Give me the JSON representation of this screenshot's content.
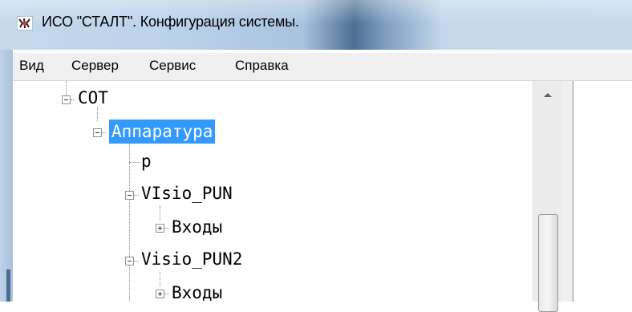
{
  "window": {
    "title": "ИСО \"СТАЛТ\". Конфигурация системы.",
    "icon": "app-logo-icon"
  },
  "menu": {
    "items": [
      "Вид",
      "Сервер",
      "Сервис",
      "Справка"
    ]
  },
  "tree": {
    "nodes": [
      {
        "label": "СОТ",
        "expander": "minus"
      },
      {
        "label": "Аппаратура",
        "expander": "minus",
        "selected": true
      },
      {
        "label": "p",
        "expander": "none"
      },
      {
        "label": "VIsio_PUN",
        "expander": "minus"
      },
      {
        "label": "Входы",
        "expander": "plus"
      },
      {
        "label": "Visio_PUN2",
        "expander": "minus"
      },
      {
        "label": "Входы",
        "expander": "plus"
      }
    ],
    "selection_color": "#3399ff"
  },
  "scrollbar": {
    "up_icon": "scroll-up-arrow-icon"
  }
}
